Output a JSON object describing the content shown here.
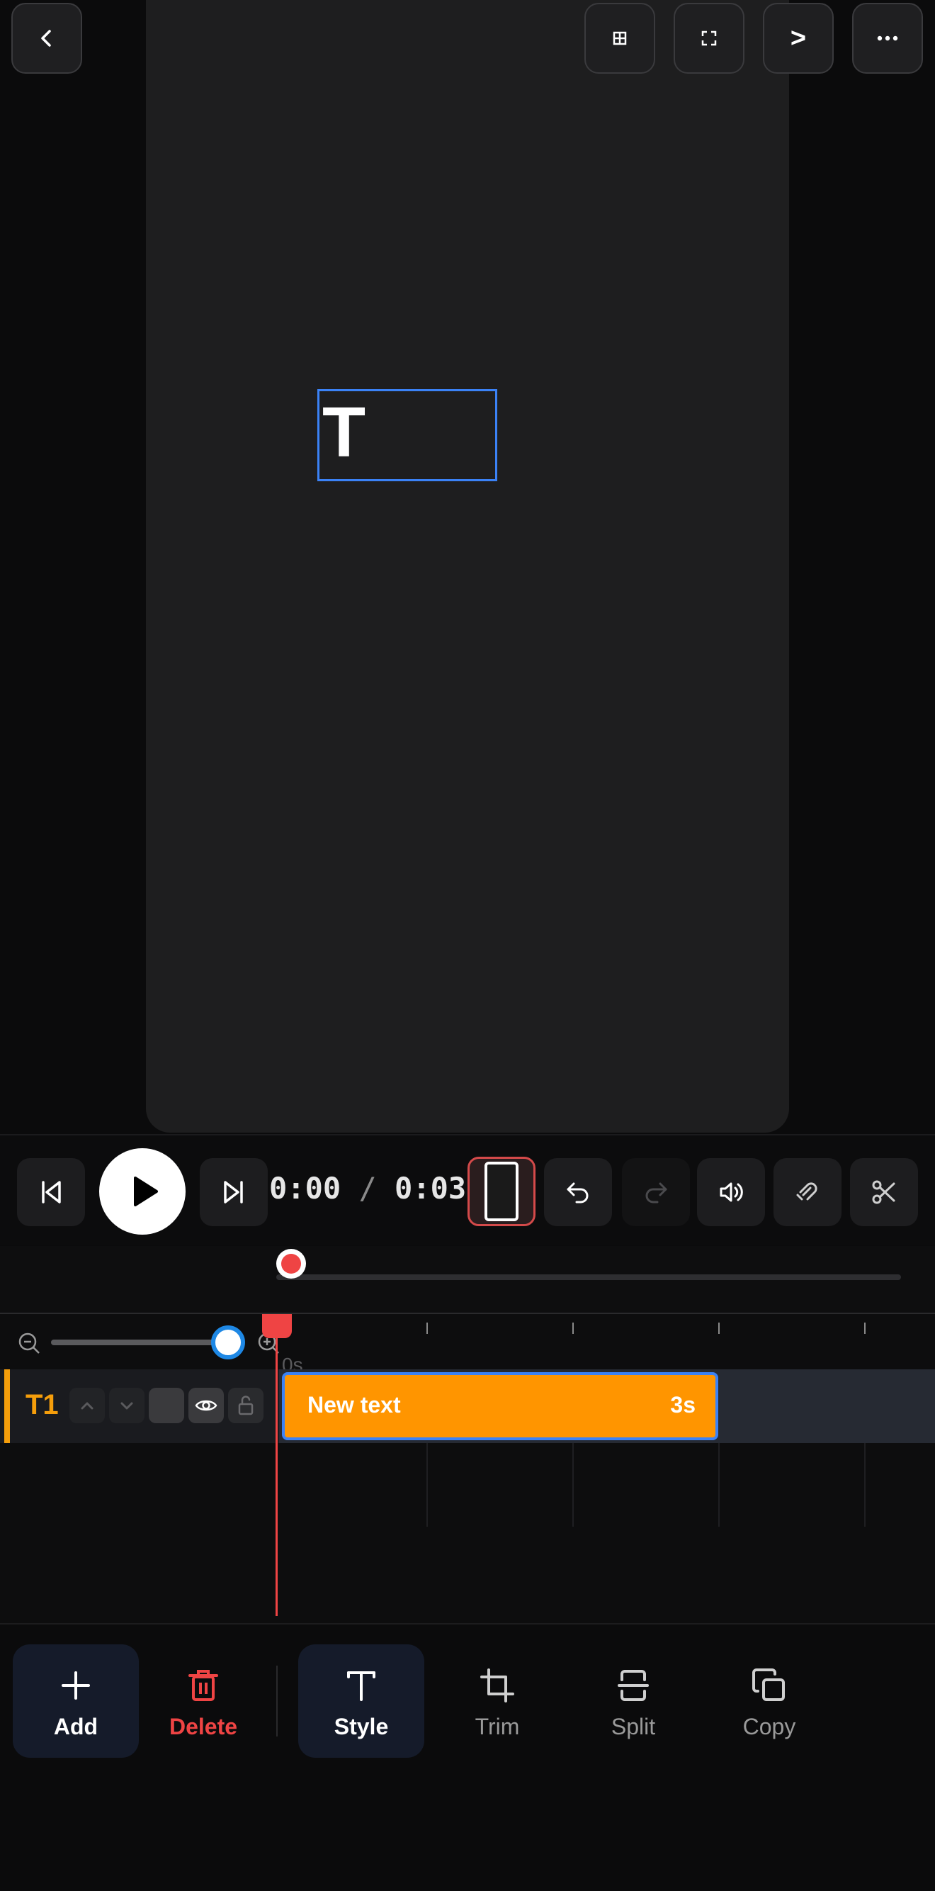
{
  "top_toolbar": {
    "back_icon": "chevron-left-icon",
    "grid_icon": "grid-icon",
    "fullscreen_icon": "fullscreen-icon",
    "next_label": ">",
    "more_icon": "more-horizontal-icon"
  },
  "preview": {
    "text_element": "T"
  },
  "playback": {
    "current_time": "0:00",
    "separator": "/",
    "total_time": "0:03"
  },
  "timeline": {
    "ruler_start_label": "0s",
    "track": {
      "label": "T1",
      "label_color": "#f59e0b",
      "clip_label": "New text",
      "clip_duration": "3s",
      "clip_color": "#ff9500"
    },
    "playhead_color": "#ef4444"
  },
  "bottom_toolbar": {
    "items": [
      {
        "label": "Add",
        "icon": "plus-icon"
      },
      {
        "label": "Delete",
        "icon": "trash-icon",
        "color": "#ef4444"
      },
      {
        "label": "Style",
        "icon": "text-icon"
      },
      {
        "label": "Trim",
        "icon": "crop-icon"
      },
      {
        "label": "Split",
        "icon": "split-icon"
      },
      {
        "label": "Copy",
        "icon": "copy-icon"
      }
    ]
  }
}
